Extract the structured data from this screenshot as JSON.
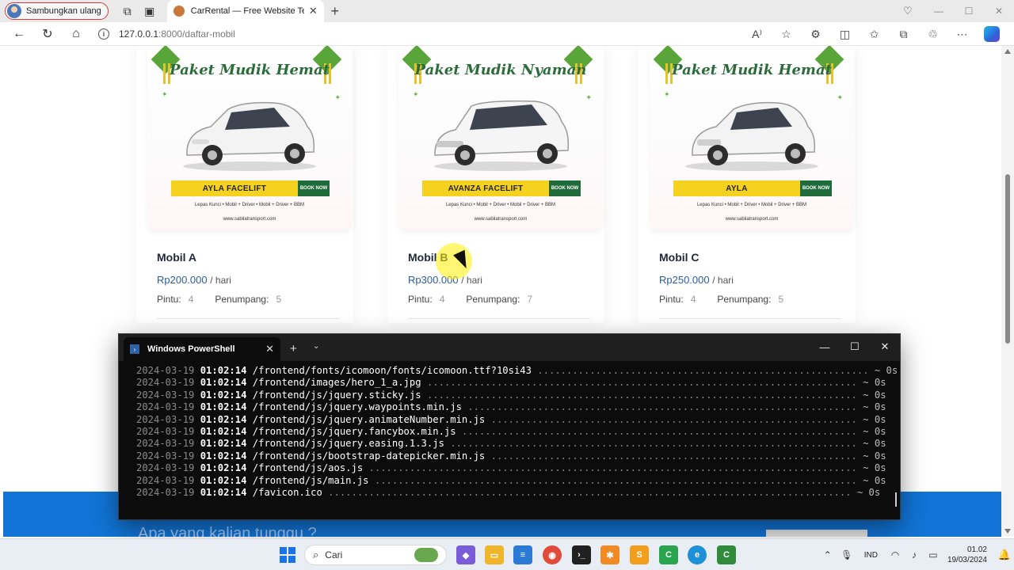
{
  "browser": {
    "profile_label": "Sambungkan ulang",
    "tab_title": "CarRental — Free Website Templ",
    "url_host": "127.0.0.1",
    "url_rest": ":8000/daftar-mobil"
  },
  "cars": [
    {
      "name": "Mobil A",
      "price": "Rp200.000",
      "per": "/ hari",
      "doors_label": "Pintu:",
      "doors": "4",
      "seats_label": "Penumpang:",
      "seats": "5",
      "banner": {
        "promo": "Paket Mudik Hemat",
        "model": "AYLA FACELIFT",
        "book": "BOOK NOW",
        "services": "Lepas Kunci  •  Mobil + Driver  •  Mobil + Driver + BBM",
        "site": "www.sabilatransport.com"
      }
    },
    {
      "name": "Mobil B",
      "price": "Rp300.000",
      "per": "/ hari",
      "doors_label": "Pintu:",
      "doors": "4",
      "seats_label": "Penumpang:",
      "seats": "7",
      "banner": {
        "promo": "Paket Mudik Nyaman",
        "model": "AVANZA FACELIFT",
        "book": "BOOK NOW",
        "services": "Lepas Kunci  •  Mobil + Driver  •  Mobil + Driver + BBM",
        "site": "www.sabilatransport.com"
      }
    },
    {
      "name": "Mobil C",
      "price": "Rp250.000",
      "per": "/ hari",
      "doors_label": "Pintu:",
      "doors": "4",
      "seats_label": "Penumpang:",
      "seats": "5",
      "banner": {
        "promo": "Paket Mudik Hemat",
        "model": "AYLA",
        "book": "BOOK NOW",
        "services": "Lepas Kunci  •  Mobil + Driver  •  Mobil + Driver + BBM",
        "site": "www.sabilatransport.com"
      }
    }
  ],
  "cta": {
    "question": "Apa yang kalian tunggu ?"
  },
  "powershell": {
    "title": "Windows PowerShell",
    "lines": [
      {
        "date": "2024-03-19",
        "time": "01:02:14",
        "path": "/frontend/fonts/icomoon/fonts/icomoon.ttf?10si43",
        "dots": " .........................................................",
        "dur": " ~ 0s"
      },
      {
        "date": "2024-03-19",
        "time": "01:02:14",
        "path": "/frontend/images/hero_1_a.jpg",
        "dots": " ..........................................................................",
        "dur": " ~ 0s"
      },
      {
        "date": "2024-03-19",
        "time": "01:02:14",
        "path": "/frontend/js/jquery.sticky.js",
        "dots": " ..........................................................................",
        "dur": " ~ 0s"
      },
      {
        "date": "2024-03-19",
        "time": "01:02:14",
        "path": "/frontend/js/jquery.waypoints.min.js",
        "dots": " ...................................................................",
        "dur": " ~ 0s"
      },
      {
        "date": "2024-03-19",
        "time": "01:02:14",
        "path": "/frontend/js/jquery.animateNumber.min.js",
        "dots": " ...............................................................",
        "dur": " ~ 0s"
      },
      {
        "date": "2024-03-19",
        "time": "01:02:14",
        "path": "/frontend/js/jquery.fancybox.min.js",
        "dots": " ....................................................................",
        "dur": " ~ 0s"
      },
      {
        "date": "2024-03-19",
        "time": "01:02:14",
        "path": "/frontend/js/jquery.easing.1.3.js",
        "dots": " ......................................................................",
        "dur": " ~ 0s"
      },
      {
        "date": "2024-03-19",
        "time": "01:02:14",
        "path": "/frontend/js/bootstrap-datepicker.min.js",
        "dots": " ...............................................................",
        "dur": " ~ 0s"
      },
      {
        "date": "2024-03-19",
        "time": "01:02:14",
        "path": "/frontend/js/aos.js",
        "dots": " ....................................................................................",
        "dur": " ~ 0s"
      },
      {
        "date": "2024-03-19",
        "time": "01:02:14",
        "path": "/frontend/js/main.js",
        "dots": " ...................................................................................",
        "dur": " ~ 0s"
      },
      {
        "date": "2024-03-19",
        "time": "01:02:14",
        "path": "/favicon.ico",
        "dots": " ..........................................................................................",
        "dur": " ~ 0s"
      }
    ]
  },
  "taskbar": {
    "search_label": "Cari",
    "lang": "IND",
    "time": "01.02",
    "date": "19/03/2024"
  },
  "colors": {
    "price_blue": "#2a5d9c",
    "cta_band": "#1174d6",
    "banner_yellow": "#f4d21f",
    "banner_green": "#1f6b3a"
  },
  "icons": [
    "avatar-icon",
    "workspaces-icon",
    "tab-actions-icon",
    "back-icon",
    "refresh-icon",
    "home-icon",
    "info-icon",
    "read-aloud-icon",
    "favorite-star-icon",
    "extensions-icon",
    "split-screen-icon",
    "favorites-icon",
    "collections-icon",
    "profile-sync-icon",
    "more-icon",
    "copilot-icon",
    "windows-start-icon",
    "search-icon",
    "powershell-icon"
  ]
}
